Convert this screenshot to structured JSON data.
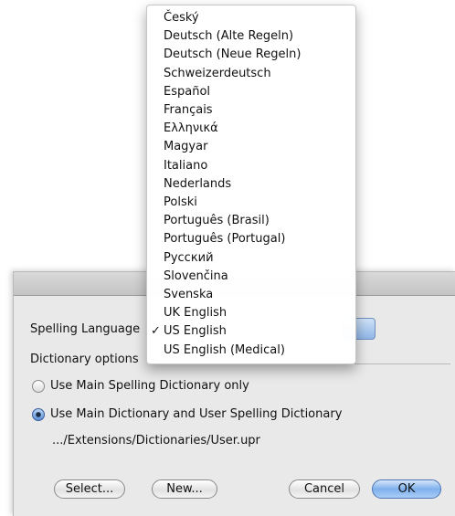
{
  "dialog": {
    "spelling_language_label": "Spelling Language",
    "dictionary_options_label": "Dictionary options",
    "radio_main_only": "Use Main Spelling Dictionary only",
    "radio_main_and_user": "Use Main Dictionary and User Spelling Dictionary",
    "user_dictionary_path": ".../Extensions/Dictionaries/User.upr",
    "buttons": {
      "select": "Select...",
      "new": "New...",
      "cancel": "Cancel",
      "ok": "OK"
    }
  },
  "menu": {
    "check_mark": "✓",
    "items": [
      "Český",
      "Deutsch (Alte Regeln)",
      "Deutsch (Neue Regeln)",
      "Schweizerdeutsch",
      "Español",
      "Français",
      "Ελληνικά",
      "Magyar",
      "Italiano",
      "Nederlands",
      "Polski",
      "Português (Brasil)",
      "Português (Portugal)",
      "Русский",
      "Slovenčina",
      "Svenska",
      "UK English",
      "US English",
      "US English (Medical)"
    ],
    "selected_index": 17
  }
}
